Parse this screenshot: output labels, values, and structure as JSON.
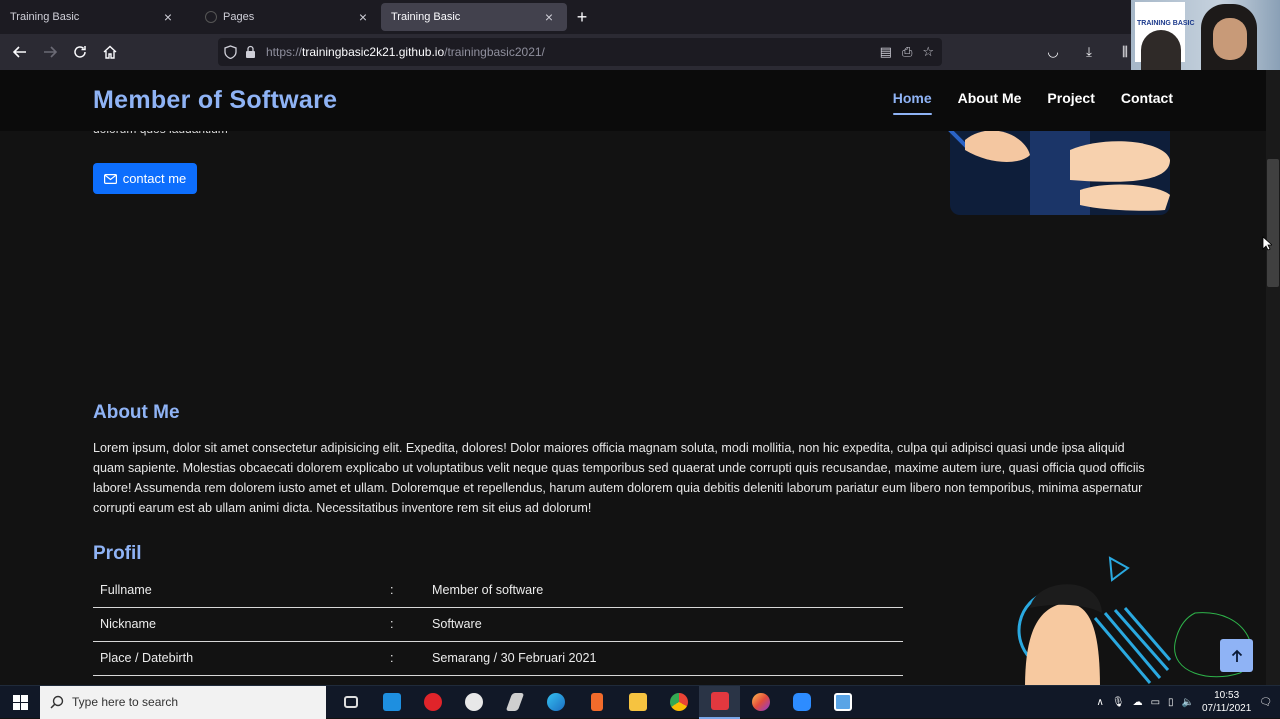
{
  "browser": {
    "tabs": [
      {
        "title": "Training Basic",
        "active": false
      },
      {
        "title": "Pages",
        "active": false
      },
      {
        "title": "Training Basic",
        "active": true
      }
    ],
    "url_prefix": "https://",
    "url_host": "trainingbasic2k21.github.io",
    "url_path": "/trainingbasic2021/"
  },
  "webcam": {
    "banner_text": "TRAINING BASIC"
  },
  "site": {
    "brand": "Member of Software",
    "nav": [
      {
        "label": "Home",
        "active": true
      },
      {
        "label": "About Me",
        "active": false
      },
      {
        "label": "Project",
        "active": false
      },
      {
        "label": "Contact",
        "active": false
      }
    ],
    "hero_clipped_text": "dolorum quos laudantium",
    "contact_button": "contact me",
    "about": {
      "title": "About Me",
      "text": "Lorem ipsum, dolor sit amet consectetur adipisicing elit. Expedita, dolores! Dolor maiores officia magnam soluta, modi mollitia, non hic expedita, culpa qui adipisci quasi unde ipsa aliquid quam sapiente. Molestias obcaecati dolorem explicabo ut voluptatibus velit neque quas temporibus sed quaerat unde corrupti quis recusandae, maxime autem iure, quasi officia quod officiis labore! Assumenda rem dolorem iusto amet et ullam. Doloremque et repellendus, harum autem dolorem quia debitis deleniti laborum pariatur eum libero non temporibus, minima aspernatur corrupti earum est ab ullam animi dicta. Necessitatibus inventore rem sit eius ad dolorum!"
    },
    "profil": {
      "title": "Profil",
      "rows": [
        {
          "label": "Fullname",
          "sep": ":",
          "value": "Member of software"
        },
        {
          "label": "Nickname",
          "sep": ":",
          "value": "Software"
        },
        {
          "label": "Place / Datebirth",
          "sep": ":",
          "value": "Semarang / 30 Februari 2021"
        }
      ]
    }
  },
  "taskbar": {
    "search_placeholder": "Type here to search",
    "time": "10:53",
    "date": "07/11/2021"
  },
  "colors": {
    "accent": "#8fb3f5",
    "button": "#0d6efd",
    "background": "#121212"
  }
}
